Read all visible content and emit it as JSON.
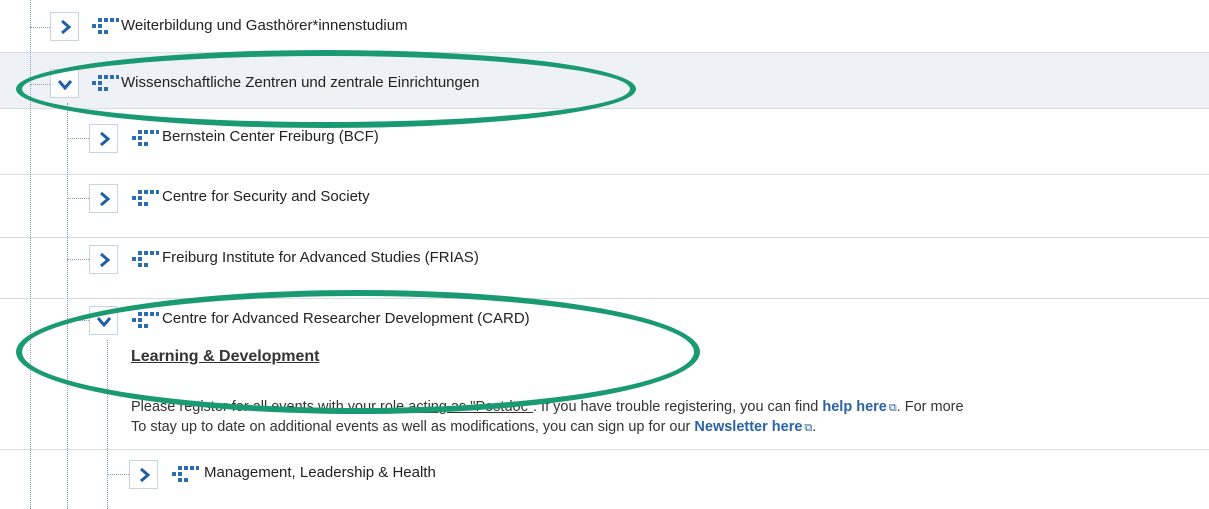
{
  "tree": {
    "items": [
      {
        "label": "Weiterbildung und Gasthörer*innenstudium",
        "state": "collapsed"
      },
      {
        "label": "Wissenschaftliche Zentren und zentrale Einrichtungen",
        "state": "expanded"
      },
      {
        "label": "Bernstein Center Freiburg (BCF)",
        "state": "collapsed"
      },
      {
        "label": "Centre for Security and Society",
        "state": "collapsed"
      },
      {
        "label": "Freiburg Institute for Advanced Studies (FRIAS)",
        "state": "collapsed"
      },
      {
        "label": "Centre for Advanced Researcher Development (CARD)",
        "state": "expanded"
      },
      {
        "label": "Management, Leadership & Health",
        "state": "collapsed"
      }
    ]
  },
  "card": {
    "heading": "Learning & Development",
    "line1_pre": "Please register for all events with your ",
    "line1_link": "role acting as \"Postdoc\"",
    "line1_mid": ". If you have trouble registering, you can find ",
    "line1_help": "help here",
    "line1_post": ". For more",
    "line2_pre": "To stay up to date on additional events as well as modifications, you can sign up for our ",
    "line2_link": "Newsletter here",
    "line2_post": "."
  },
  "icons": {
    "expand": "chevron-right-icon",
    "collapse": "chevron-down-icon",
    "folder": "tree-node-icon",
    "external": "external-link-icon"
  },
  "colors": {
    "highlight_ring": "#1a9a72",
    "chevron": "#1f5fa8",
    "link": "#2962a6",
    "row_alt": "#eef1f5"
  }
}
